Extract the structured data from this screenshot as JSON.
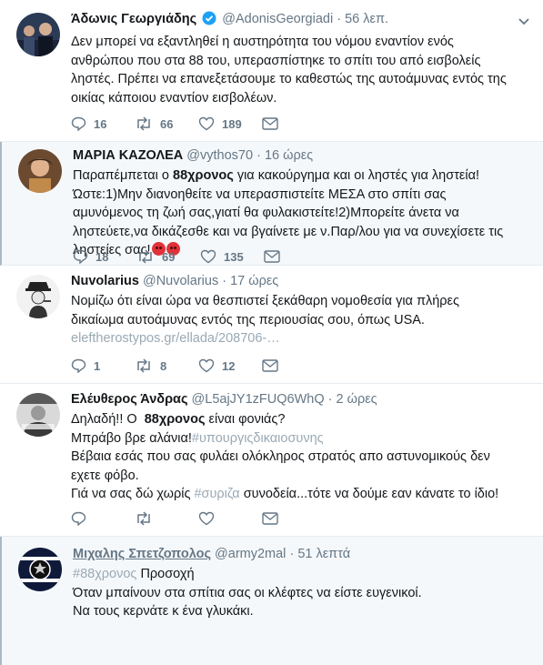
{
  "tweets": [
    {
      "name": "Άδωνις Γεωργιάδης",
      "handle": "@AdonisGeorgiadi",
      "time": "56 λεπ.",
      "text": "Δεν μπορεί να εξαντληθεί η αυστηρότητα του νόμου εναντίον ενός ανθρώπου που στα 88 του, υπερασπίστηκε το σπίτι του από εισβολείς ληστές. Πρέπει να επανεξετάσουμε το καθεστώς της αυτοάμυνας εντός της οικίας κάποιου εναντίον εισβολέων.",
      "replies": "16",
      "retweets": "66",
      "likes": "189"
    },
    {
      "name": "ΜΑΡΙΑ ΚΑΖΟΛΕΑ",
      "handle": "@vythos70",
      "time": "16 ώρες",
      "line1_a": "Παραπέμπεται ο ",
      "line1_b": "88χρονος",
      "line1_c": " για κακούργημα και οι ληστές για ληστεία!",
      "line2": "Ώστε:1)Μην διανοηθείτε να υπερασπιστείτε ΜΕΣΑ στο σπίτι σας αμυνόμενος τη ζωή σας,γιατί θα φυλακιστείτε!2)Μπορείτε άνετα να ληστεύετε,να δικάζεσθε και να βγαίνετε με ν.Παρ/λου για να συνεχίσετε τις ληστείες σας!",
      "replies": "18",
      "retweets": "69",
      "likes": "135"
    },
    {
      "name": "Nuvolarius",
      "handle": "@Nuvolarius",
      "time": "17 ώρες",
      "text": "Νομίζω ότι είναι ώρα να θεσπιστεί ξεκάθαρη νομοθεσία για πλήρες δικαίωμα αυτοάμυνας εντός της περιουσίας σου, όπως USA.",
      "link": "eleftherostypos.gr/ellada/208706-…",
      "replies": "1",
      "retweets": "8",
      "likes": "12"
    },
    {
      "name": "Ελέυθερος Άνδρας",
      "handle": "@L5ajJY1zFUQ6WhQ",
      "time": "2 ώρες",
      "l1_a": "Δηλαδή!! Ο  ",
      "l1_b": "88χρονος",
      "l1_c": " είναι φονιάς?",
      "l2_a": "Μπράβο βρε αλάνια!",
      "l2_b": "#υπουργιςδικαιοσυνης",
      "l3": "Βέβαια εσάς που σας φυλάει ολόκληρος στρατός απο αστυνομικούς δεν εχετε φόβο.",
      "l4_a": "Γιά να σας δώ χωρίς ",
      "l4_b": "#συριζα",
      "l4_c": " συνοδεία...τότε να δούμε εαν κάνατε το ίδιο!"
    },
    {
      "name": "Μιχαλης Σπετζοπολος",
      "handle": "@army2mal",
      "time": "51 λεπτά",
      "l1_a": "#88χρονος",
      "l1_b": " Προσοχή",
      "l2": "Όταν μπαίνουν στα σπίτια σας οι κλέφτες να είστε ευγενικοί.",
      "l3": "Να τους κερνάτε κ ένα γλυκάκι."
    }
  ],
  "dot": "·",
  "icons": [
    "reply-icon",
    "retweet-icon",
    "like-icon",
    "message-icon",
    "chevron-down-icon",
    "verified-icon"
  ]
}
